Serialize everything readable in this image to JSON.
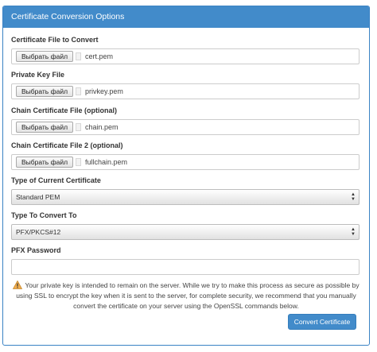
{
  "panel": {
    "title": "Certificate Conversion Options"
  },
  "fields": [
    {
      "label": "Certificate File to Convert",
      "button": "Выбрать файл",
      "file": "cert.pem"
    },
    {
      "label": "Private Key File",
      "button": "Выбрать файл",
      "file": "privkey.pem"
    },
    {
      "label": "Chain Certificate File (optional)",
      "button": "Выбрать файл",
      "file": "chain.pem"
    },
    {
      "label": "Chain Certificate File 2 (optional)",
      "button": "Выбрать файл",
      "file": "fullchain.pem"
    }
  ],
  "current_type": {
    "label": "Type of Current Certificate",
    "value": "Standard PEM"
  },
  "convert_to": {
    "label": "Type To Convert To",
    "value": "PFX/PKCS#12"
  },
  "pfx_password": {
    "label": "PFX Password",
    "value": ""
  },
  "warning": {
    "line1": "Your private key is intended to remain on the server. While we try to make this process as secure as possible by",
    "line2": "using SSL to encrypt the key when it is sent to the server, for complete security, we recommend that you manually",
    "line3": "convert the certificate on your server using the OpenSSL commands below.",
    "icon": "warning-icon",
    "icon_color": "#f0ad4e"
  },
  "submit": {
    "label": "Convert Certificate"
  },
  "colors": {
    "accent": "#428bca",
    "border": "#3a82c4"
  }
}
